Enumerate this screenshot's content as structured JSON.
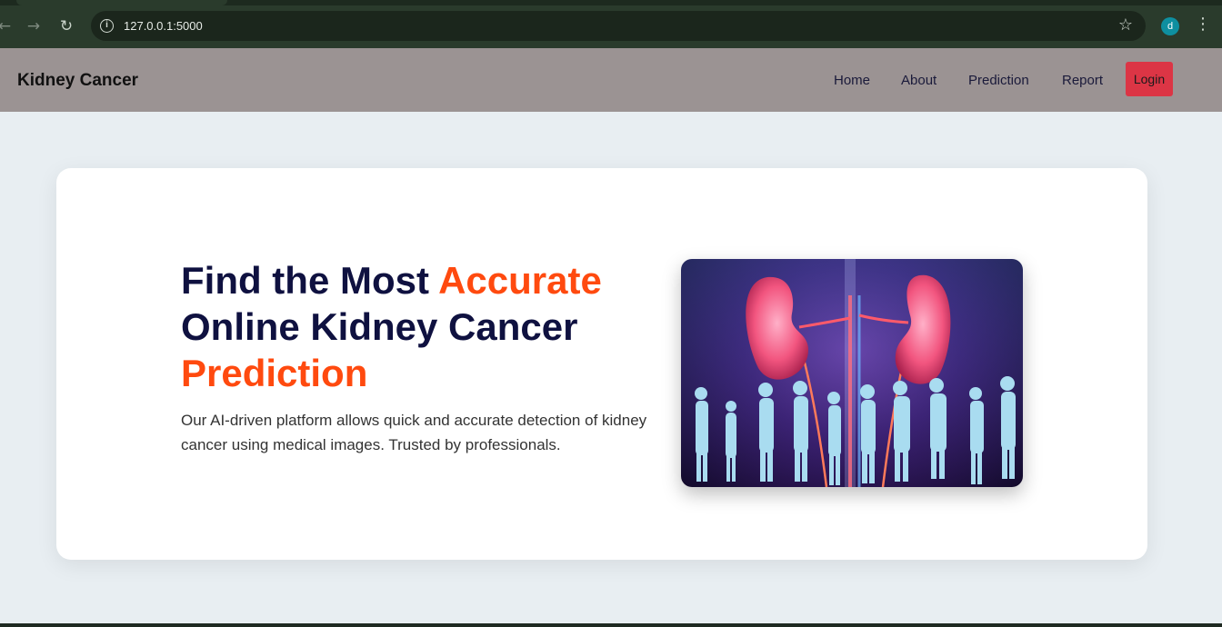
{
  "browser": {
    "url": "127.0.0.1:5000",
    "profile_initial": "d"
  },
  "site": {
    "brand": "Kidney Cancer",
    "nav": {
      "home": "Home",
      "about": "About",
      "prediction": "Prediction",
      "report": "Report",
      "login": "Login"
    }
  },
  "hero": {
    "title_part1": "Find the Most ",
    "title_accent1": "Accurate",
    "title_part2": "Online Kidney Cancer",
    "title_accent2": "Prediction",
    "description": "Our AI-driven platform allows quick and accurate detection of kidney cancer using medical images. Trusted by professionals."
  },
  "colors": {
    "accent": "#ff4a0f",
    "title": "#0f1140",
    "navbar": "#9b9393",
    "login_button": "#dc3545",
    "page_background": "#e8eef2"
  }
}
